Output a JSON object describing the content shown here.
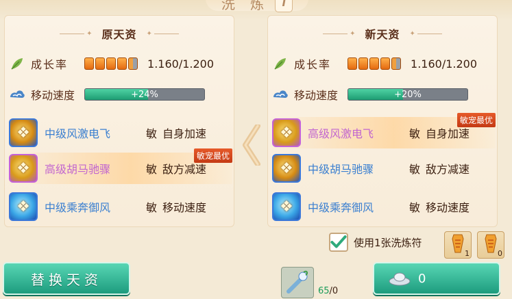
{
  "header": {
    "title": "洗 炼",
    "info_glyph": "i"
  },
  "left_panel": {
    "title": "原天资",
    "growth": {
      "label": "成长率",
      "value": "1.160/1.200",
      "pips": 5
    },
    "speed": {
      "label": "移动速度",
      "bonus": "+24%",
      "fill": 0.53
    },
    "skills": [
      {
        "name": "中级风激电飞",
        "tag": "敏",
        "effect": "自身加速",
        "color": "blue",
        "highlight": false,
        "badge": ""
      },
      {
        "name": "高级胡马驰骤",
        "tag": "敏",
        "effect": "敌方减速",
        "color": "pink",
        "highlight": true,
        "badge": "敏宠最优"
      },
      {
        "name": "中级乘奔御风",
        "tag": "敏",
        "effect": "移动速度",
        "color": "blue",
        "highlight": false,
        "badge": ""
      }
    ]
  },
  "right_panel": {
    "title": "新天资",
    "growth": {
      "label": "成长率",
      "value": "1.160/1.200",
      "pips": 5
    },
    "speed": {
      "label": "移动速度",
      "bonus": "+20%",
      "fill": 0.46
    },
    "skills": [
      {
        "name": "高级风激电飞",
        "tag": "敏",
        "effect": "自身加速",
        "color": "pink",
        "highlight": true,
        "badge": "敏宠最优"
      },
      {
        "name": "中级胡马驰骤",
        "tag": "敏",
        "effect": "敌方减速",
        "color": "blue",
        "highlight": false,
        "badge": ""
      },
      {
        "name": "中级乘奔御风",
        "tag": "敏",
        "effect": "移动速度",
        "color": "blue",
        "highlight": false,
        "badge": ""
      }
    ]
  },
  "use_option": {
    "label": "使用1张洗炼符",
    "checked": true
  },
  "items": [
    {
      "icon": "talisman-icon",
      "count": "1"
    },
    {
      "icon": "talisman-icon",
      "count": "0"
    }
  ],
  "buttons": {
    "replace_label": "替换天资",
    "cost_value": "0"
  },
  "elixir": {
    "have": "65",
    "need": "/0"
  },
  "colors": {
    "accent": "#1d9c7e",
    "skill_blue": "#3a7fd0",
    "skill_pink": "#c266cf",
    "badge": "#d4461c"
  }
}
